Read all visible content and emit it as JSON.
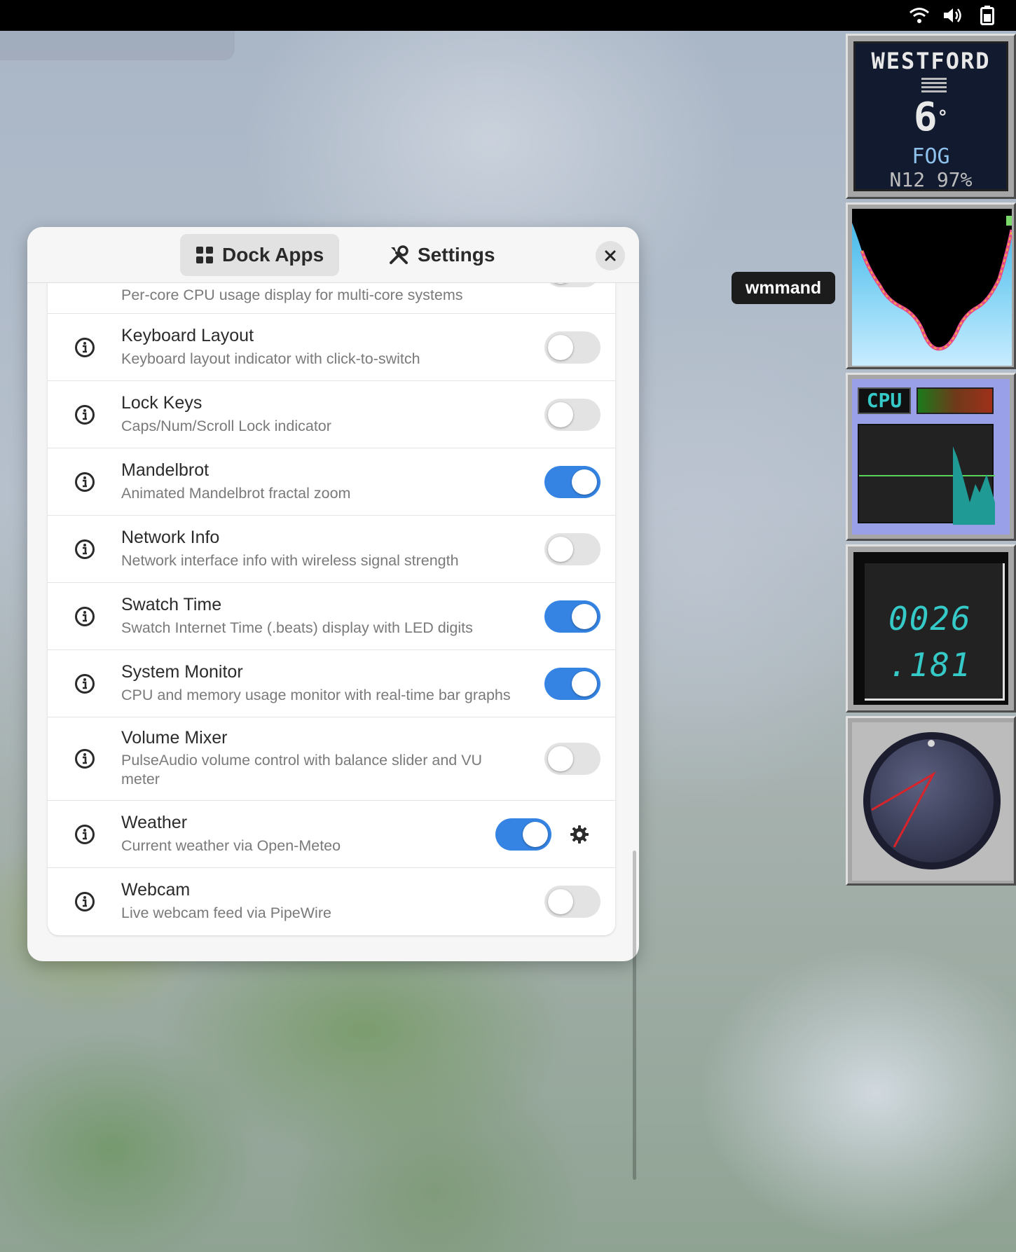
{
  "tray": {
    "wifi_icon": "wifi-icon",
    "volume_icon": "volume-icon",
    "battery_icon": "battery-icon"
  },
  "dialog": {
    "tabs": [
      {
        "label": "Dock Apps",
        "icon": "grid-icon",
        "active": true
      },
      {
        "label": "Settings",
        "icon": "tools-icon",
        "active": false
      }
    ],
    "close_icon": "close-icon",
    "rows": [
      {
        "title": "",
        "desc": "Per-core CPU usage display for multi-core systems",
        "enabled": false
      },
      {
        "title": "Keyboard Layout",
        "desc": "Keyboard layout indicator with click-to-switch",
        "enabled": false
      },
      {
        "title": "Lock Keys",
        "desc": "Caps/Num/Scroll Lock indicator",
        "enabled": false
      },
      {
        "title": "Mandelbrot",
        "desc": "Animated Mandelbrot fractal zoom",
        "enabled": true
      },
      {
        "title": "Network Info",
        "desc": "Network interface info with wireless signal strength",
        "enabled": false
      },
      {
        "title": "Swatch Time",
        "desc": "Swatch Internet Time (.beats) display with LED digits",
        "enabled": true
      },
      {
        "title": "System Monitor",
        "desc": "CPU and memory usage monitor with real-time bar graphs",
        "enabled": true
      },
      {
        "title": "Volume Mixer",
        "desc": "PulseAudio volume control with balance slider and VU meter",
        "enabled": false
      },
      {
        "title": "Weather",
        "desc": "Current weather via Open-Meteo",
        "enabled": true,
        "has_settings": true
      },
      {
        "title": "Webcam",
        "desc": "Live webcam feed via PipeWire",
        "enabled": false
      }
    ]
  },
  "tooltip": {
    "text": "wmmand"
  },
  "dock": {
    "weather": {
      "city": "WESTFORD",
      "temp": "6",
      "degree": "°",
      "condition": "FOG",
      "wind_humidity": "N12 97%"
    },
    "cpu": {
      "label": "CPU"
    },
    "swatch": {
      "beats_top": "0026",
      "beats_bottom": ".181"
    },
    "volume_knob": {
      "icon": "volume-knob"
    }
  },
  "colors": {
    "accent": "#3584e4",
    "toggle_off": "#e3e3e3",
    "lcd": "#35c9c7"
  }
}
